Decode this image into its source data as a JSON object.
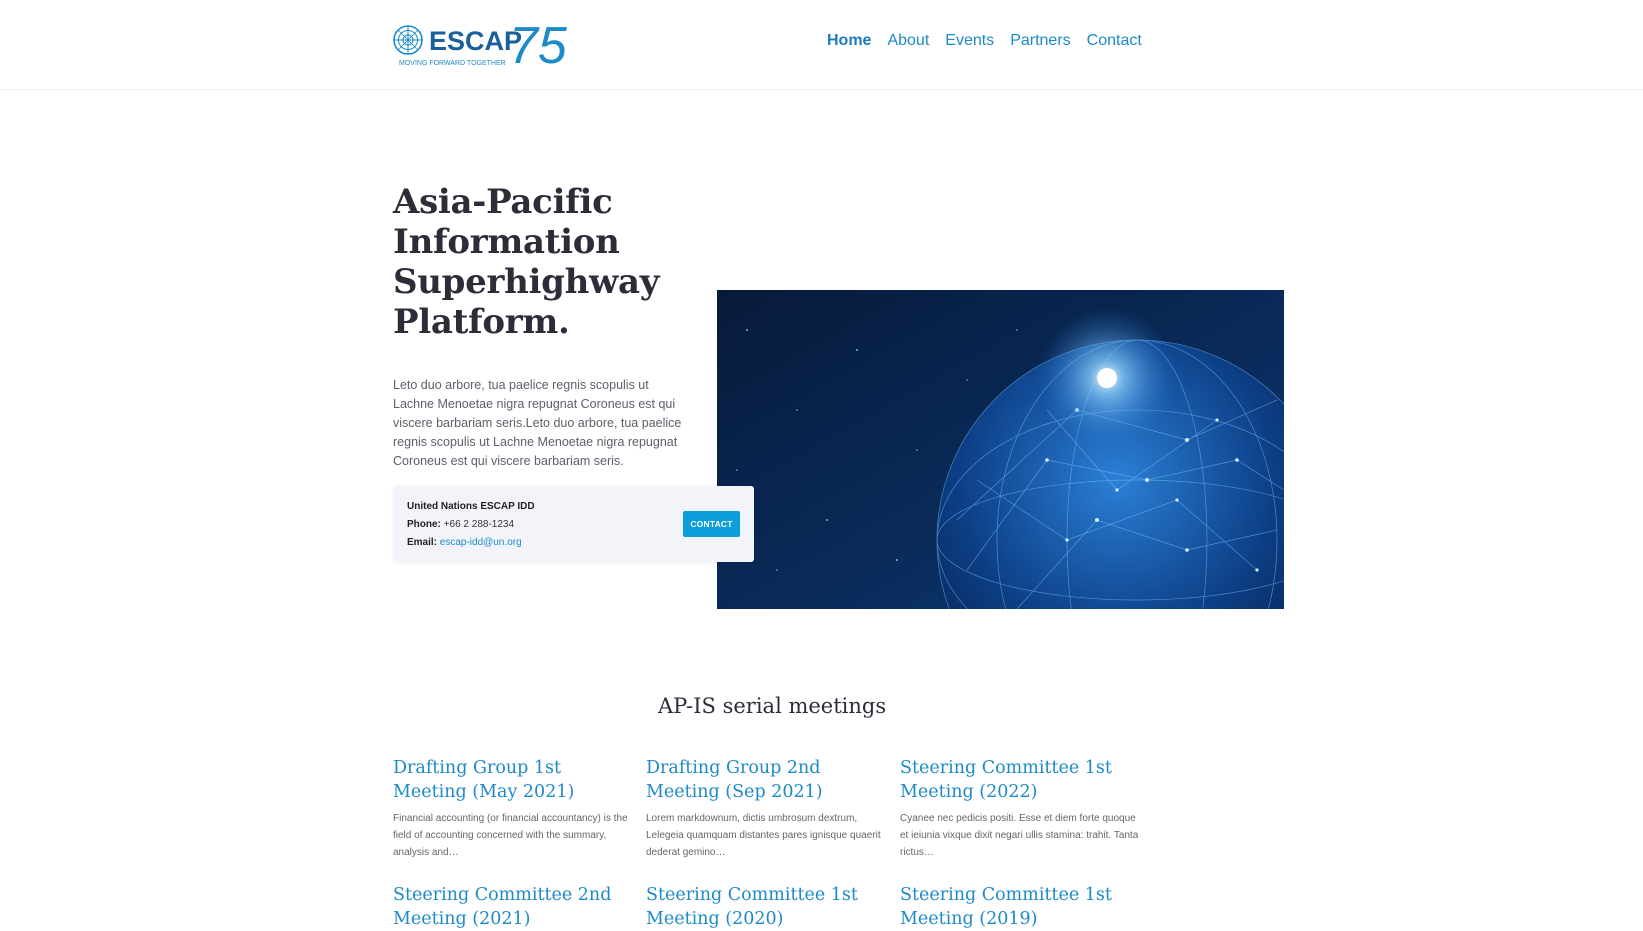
{
  "brand": {
    "name": "ESCAP",
    "anniversary": "75",
    "tagline": "MOVING FORWARD TOGETHER",
    "colors": {
      "primary": "#1d8ac9",
      "button": "#0b9ed9",
      "heading": "#2d2d3a"
    }
  },
  "nav": {
    "items": [
      {
        "label": "Home",
        "active": true
      },
      {
        "label": "About"
      },
      {
        "label": "Events"
      },
      {
        "label": "Partners"
      },
      {
        "label": "Contact"
      }
    ]
  },
  "hero": {
    "title": "Asia-Pacific Information Superhighway Platform.",
    "text": "Leto duo arbore, tua paelice regnis scopulis ut Lachne Menoetae nigra repugnat Coroneus est qui viscere barbariam seris.Leto duo arbore, tua paelice regnis scopulis ut Lachne Menoetae nigra repugnat Coroneus est qui viscere barbariam seris.",
    "image_icon": "globe-network-image"
  },
  "contact": {
    "org": "United Nations ESCAP IDD",
    "phone_label": "Phone:",
    "phone": "+66 2 288-1234",
    "email_label": "Email:",
    "email": "escap-idd@un.org",
    "button": "CONTACT"
  },
  "meetings": {
    "title": "AP-IS serial meetings",
    "items": [
      {
        "title": "Drafting Group 1st Meeting (May 2021)",
        "excerpt": "Financial accounting (or financial accountancy) is the field of accounting concerned with the summary, analysis and…"
      },
      {
        "title": "Drafting Group 2nd Meeting (Sep 2021)",
        "excerpt": "Lorem markdownum, dictis umbrosum dextrum, Lelegeia quamquam distantes pares ignisque quaerit dederat gemino…"
      },
      {
        "title": "Steering Committee 1st Meeting (2022)",
        "excerpt": "Cyanee nec pedicis positi. Esse et diem forte quoque et ieiunia vixque dixit negari ullis stamina: trahit. Tanta rictus…"
      },
      {
        "title": "Steering Committee 2nd Meeting (2021)",
        "excerpt": ""
      },
      {
        "title": "Steering Committee 1st Meeting (2020)",
        "excerpt": ""
      },
      {
        "title": "Steering Committee 1st Meeting (2019)",
        "excerpt": ""
      }
    ]
  }
}
